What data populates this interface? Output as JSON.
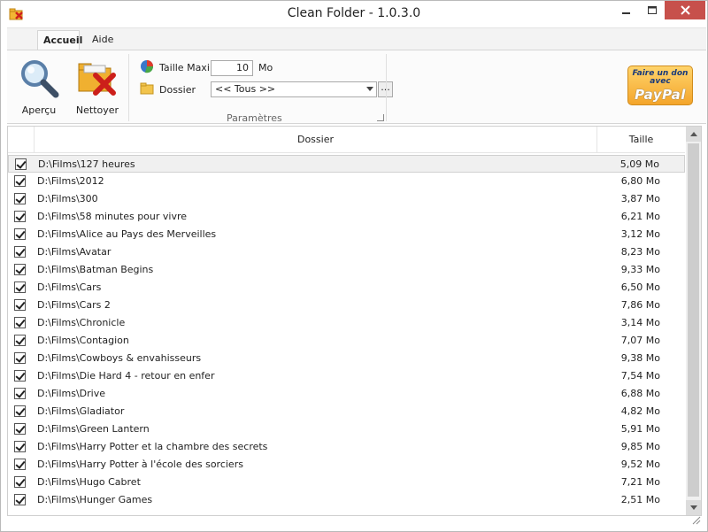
{
  "window": {
    "title": "Clean Folder - 1.0.3.0"
  },
  "tabs": {
    "home": "Accueil",
    "help": "Aide"
  },
  "ribbon": {
    "preview_label": "Aperçu",
    "clean_label": "Nettoyer",
    "max_size_label": "Taille Maxi",
    "max_size_value": "10",
    "max_size_unit": "Mo",
    "folder_label": "Dossier",
    "folder_value": "<< Tous >>",
    "browse_label": "...",
    "group_label": "Paramètres",
    "paypal_top": "Faire un don avec",
    "paypal_logo": "PayPal"
  },
  "list": {
    "headers": {
      "folder": "Dossier",
      "size": "Taille"
    },
    "rows": [
      {
        "path": "D:\\Films\\127 heures",
        "size": "5,09 Mo"
      },
      {
        "path": "D:\\Films\\2012",
        "size": "6,80 Mo"
      },
      {
        "path": "D:\\Films\\300",
        "size": "3,87 Mo"
      },
      {
        "path": "D:\\Films\\58 minutes pour vivre",
        "size": "6,21 Mo"
      },
      {
        "path": "D:\\Films\\Alice au Pays des Merveilles",
        "size": "3,12 Mo"
      },
      {
        "path": "D:\\Films\\Avatar",
        "size": "8,23 Mo"
      },
      {
        "path": "D:\\Films\\Batman Begins",
        "size": "9,33 Mo"
      },
      {
        "path": "D:\\Films\\Cars",
        "size": "6,50 Mo"
      },
      {
        "path": "D:\\Films\\Cars 2",
        "size": "7,86 Mo"
      },
      {
        "path": "D:\\Films\\Chronicle",
        "size": "3,14 Mo"
      },
      {
        "path": "D:\\Films\\Contagion",
        "size": "7,07 Mo"
      },
      {
        "path": "D:\\Films\\Cowboys & envahisseurs",
        "size": "9,38 Mo"
      },
      {
        "path": "D:\\Films\\Die Hard 4 - retour en enfer",
        "size": "7,54 Mo"
      },
      {
        "path": "D:\\Films\\Drive",
        "size": "6,88 Mo"
      },
      {
        "path": "D:\\Films\\Gladiator",
        "size": "4,82 Mo"
      },
      {
        "path": "D:\\Films\\Green Lantern",
        "size": "5,91 Mo"
      },
      {
        "path": "D:\\Films\\Harry Potter et la chambre des secrets",
        "size": "9,85 Mo"
      },
      {
        "path": "D:\\Films\\Harry Potter à l'école des sorciers",
        "size": "9,52 Mo"
      },
      {
        "path": "D:\\Films\\Hugo Cabret",
        "size": "7,21 Mo"
      },
      {
        "path": "D:\\Films\\Hunger Games",
        "size": "2,51 Mo"
      }
    ]
  }
}
